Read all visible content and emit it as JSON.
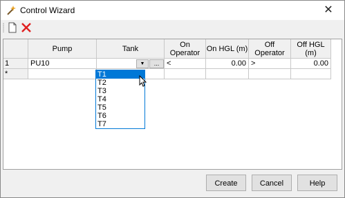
{
  "window": {
    "title": "Control Wizard",
    "close_glyph": "✕"
  },
  "toolbar": {
    "new_icon": "new-document-icon",
    "delete_icon": "delete-icon"
  },
  "grid": {
    "columns": [
      "Pump",
      "Tank",
      "On Operator",
      "On HGL (m)",
      "Off Operator",
      "Off HGL (m)"
    ],
    "rows": [
      {
        "num": "1",
        "pump": "PU10",
        "tank": "",
        "on_operator": "<",
        "on_hgl": "0.00",
        "off_operator": ">",
        "off_hgl": "0.00"
      }
    ],
    "new_row_marker": "*",
    "combo_arrow": "▼",
    "ellipsis": "..."
  },
  "dropdown": {
    "options": [
      "T1",
      "T2",
      "T3",
      "T4",
      "T5",
      "T6",
      "T7"
    ],
    "selected": "T1"
  },
  "buttons": {
    "create": "Create",
    "cancel": "Cancel",
    "help": "Help"
  },
  "colors": {
    "selection": "#0078d7",
    "grid_header": "#f0f0f0"
  }
}
